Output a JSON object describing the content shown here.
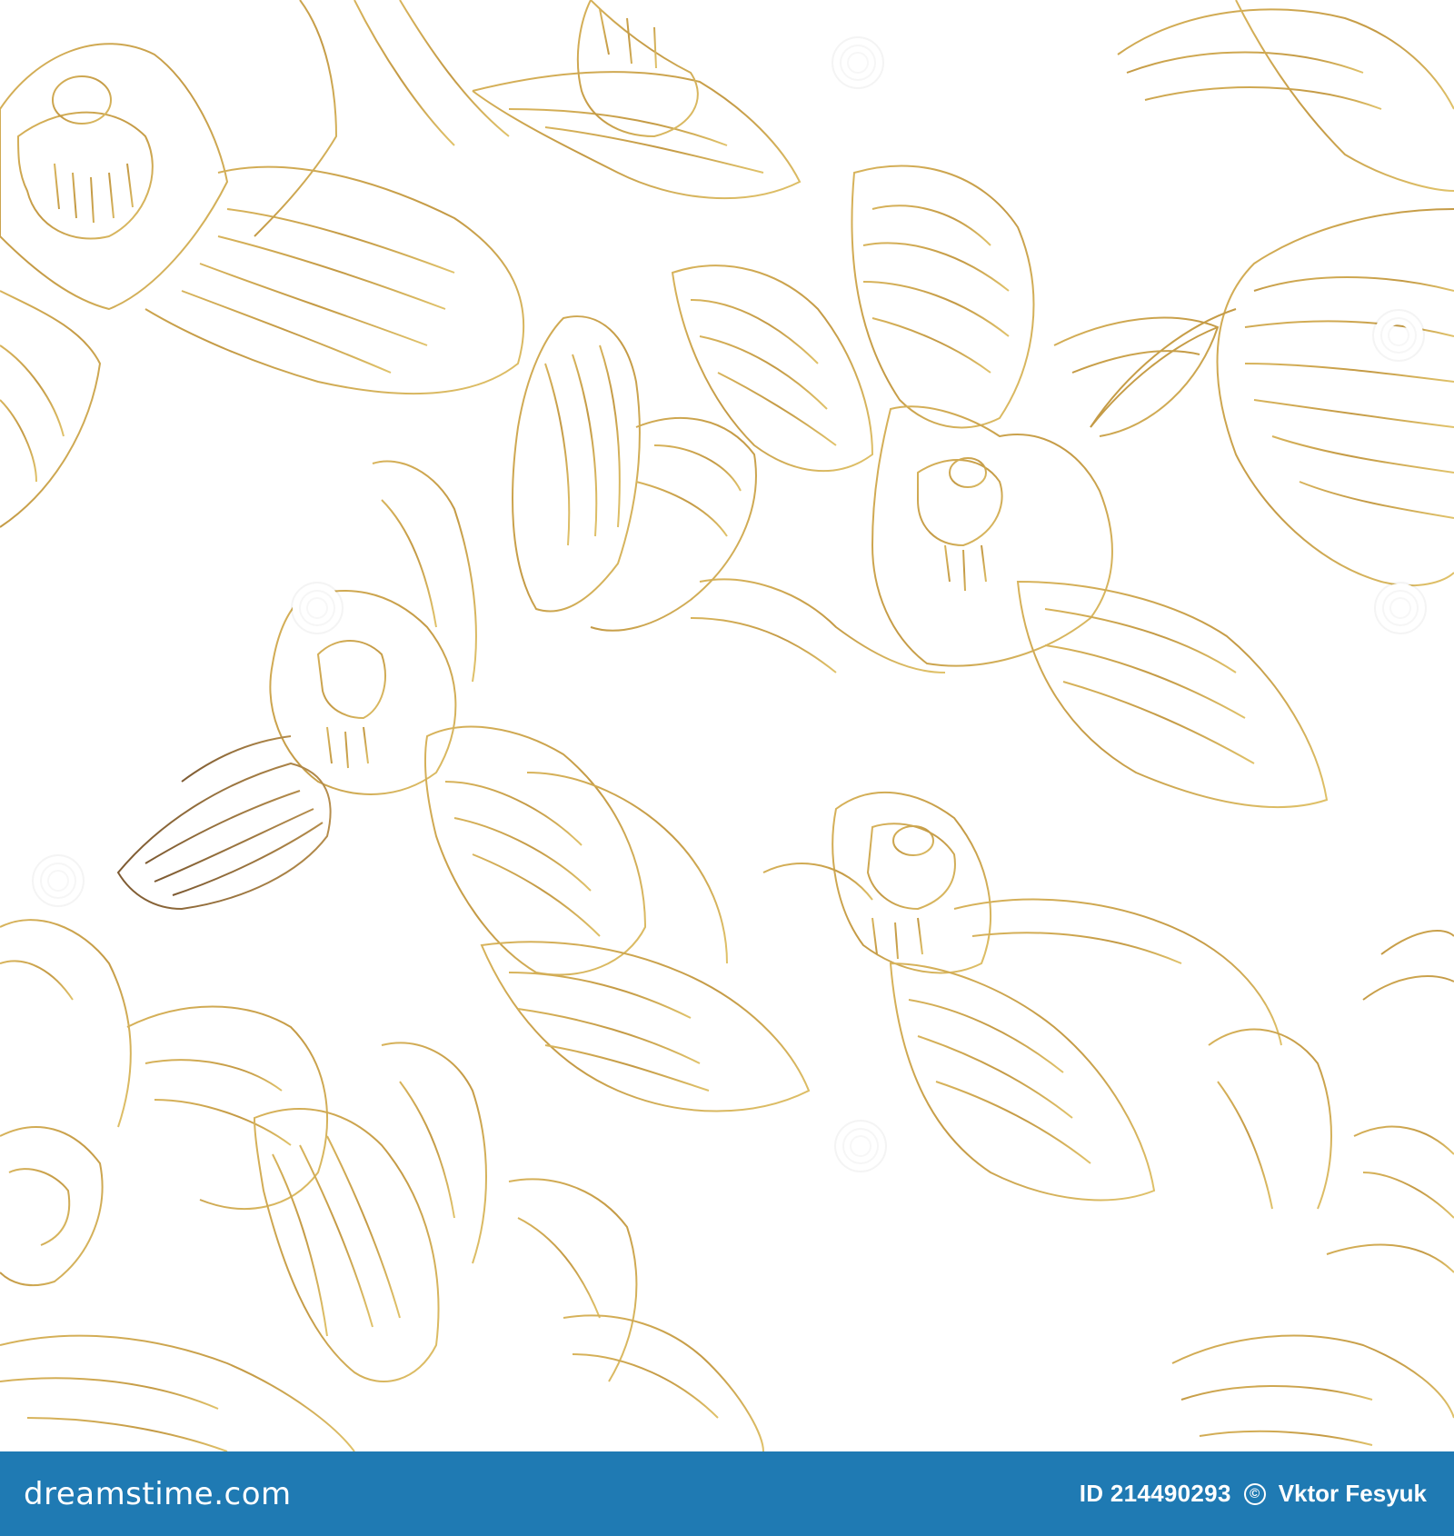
{
  "image": {
    "description_colors": {
      "background": "#ffffff",
      "line_gold": "#c9a24a",
      "line_gold_dark": "#a8823a",
      "line_bronze": "#8f6a3a",
      "footer_bar": "#1f7ab3"
    }
  },
  "footer": {
    "site_logo": "dreamstime.com",
    "id_label": "ID 214490293",
    "copyright_icon": "©",
    "author": "Vktor Fesyuk"
  }
}
